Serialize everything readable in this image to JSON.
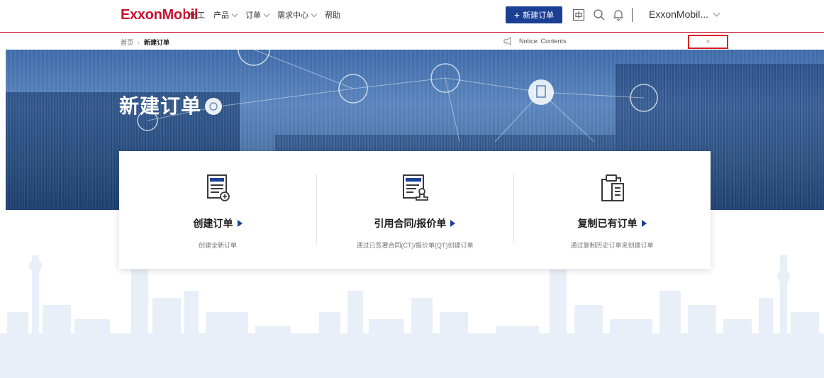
{
  "header": {
    "logo": "ExxonMobil",
    "nav": [
      {
        "label": "化工",
        "dropdown": false
      },
      {
        "label": "产品",
        "dropdown": true
      },
      {
        "label": "订单",
        "dropdown": true
      },
      {
        "label": "需求中心",
        "dropdown": true
      },
      {
        "label": "帮助",
        "dropdown": false
      }
    ],
    "new_order_label": "新建订单",
    "user_name": "ExxonMobil...",
    "icons": [
      "grid-icon",
      "search-icon",
      "bell-icon"
    ]
  },
  "subbar": {
    "breadcrumb_home": "首页",
    "breadcrumb_current": "新建订单",
    "notice": "Notice: Contents",
    "close_label": "×"
  },
  "banner": {
    "title": "新建订单"
  },
  "options": [
    {
      "title": "创建订单",
      "desc": "创建全新订单",
      "icon": "document-add-icon"
    },
    {
      "title": "引用合同/报价单",
      "desc": "通过已签署合同(CT)/报价单(QT)创建订单",
      "icon": "document-stamp-icon"
    },
    {
      "title": "复制已有订单",
      "desc": "通过复制历史订单来创建订单",
      "icon": "clipboard-copy-icon"
    }
  ],
  "colors": {
    "brand_red": "#c8102e",
    "brand_blue": "#1b3f94",
    "highlight_red": "#e02020"
  }
}
